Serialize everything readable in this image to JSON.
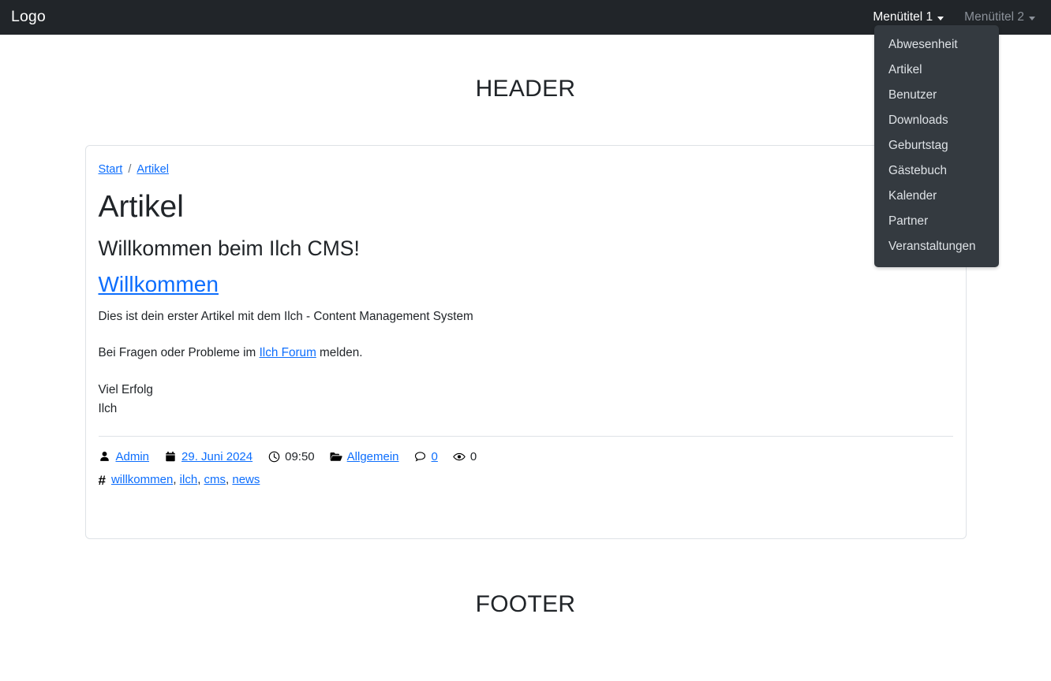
{
  "navbar": {
    "brand": "Logo",
    "items": [
      {
        "label": "Menütitel 1",
        "state": "active",
        "has_caret": true
      },
      {
        "label": "Menütitel 2",
        "state": "muted",
        "has_caret": true
      }
    ],
    "background_color": "#212529"
  },
  "dropdown": {
    "open_for": "Menütitel 1",
    "background_color": "#343a40",
    "items": [
      "Abwesenheit",
      "Artikel",
      "Benutzer",
      "Downloads",
      "Geburtstag",
      "Gästebuch",
      "Kalender",
      "Partner",
      "Veranstaltungen"
    ]
  },
  "page": {
    "header": "HEADER",
    "footer": "FOOTER"
  },
  "breadcrumb": {
    "items": [
      "Start",
      "Artikel"
    ],
    "separator": "/"
  },
  "article": {
    "title": "Artikel",
    "subtitle": "Willkommen beim Ilch CMS!",
    "headline_link": "Willkommen",
    "paragraph_1": "Dies ist dein erster Artikel mit dem Ilch - Content Management System",
    "paragraph_2_before": "Bei Fragen oder Probleme im ",
    "paragraph_2_link": "Ilch Forum",
    "paragraph_2_after": " melden.",
    "signature_line_1": "Viel Erfolg",
    "signature_line_2": "Ilch"
  },
  "meta": {
    "author_icon": "user-icon",
    "author": "Admin",
    "date_icon": "calendar-icon",
    "date": "29. Juni 2024",
    "time_icon": "clock-icon",
    "time": "09:50",
    "category_icon": "folder-icon",
    "category": "Allgemein",
    "comments_icon": "comment-icon",
    "comments": "0",
    "views_icon": "eye-icon",
    "views": "0",
    "tags_icon": "hash-icon",
    "tags": [
      "willkommen",
      "ilch",
      "cms",
      "news"
    ],
    "tag_separator": ", "
  },
  "colors": {
    "link": "#0d6efd",
    "text": "#212529",
    "border": "#dee2e6",
    "navbar": "#212529",
    "dropdown": "#343a40",
    "muted": "#8b9199"
  }
}
